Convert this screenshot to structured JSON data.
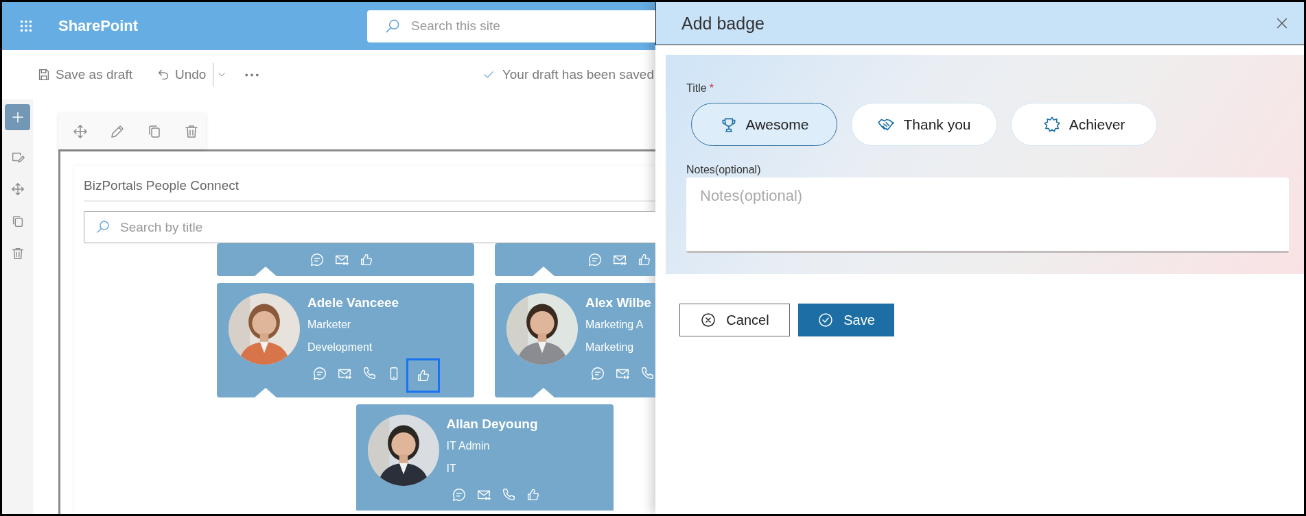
{
  "app_bar": {
    "brand": "SharePoint",
    "search": {
      "placeholder": "Search this site"
    }
  },
  "command_bar": {
    "save_draft": "Save as draft",
    "undo": "Undo",
    "status": "Your draft has been saved"
  },
  "web_part": {
    "title": "BizPortals People Connect",
    "search": {
      "placeholder": "Search by title"
    },
    "rows": [
      {
        "cards": [
          {
            "actions": [
              {
                "kind": "chat",
                "focused": false
              },
              {
                "kind": "mail",
                "focused": false
              },
              {
                "kind": "like",
                "focused": false
              }
            ]
          },
          {
            "actions": [
              {
                "kind": "chat",
                "focused": false
              },
              {
                "kind": "mail",
                "focused": false
              },
              {
                "kind": "like",
                "focused": false
              }
            ]
          }
        ]
      },
      {
        "cards": [
          {
            "name": "Adele Vanceee",
            "job_title": "Marketer",
            "department": "Development",
            "actions": [
              {
                "kind": "chat",
                "focused": false
              },
              {
                "kind": "mail",
                "focused": false
              },
              {
                "kind": "phone",
                "focused": false
              },
              {
                "kind": "mobile",
                "focused": false
              },
              {
                "kind": "like",
                "focused": true
              }
            ]
          },
          {
            "name": "Alex Wilbe",
            "job_title": "Marketing A",
            "department": "Marketing",
            "actions": [
              {
                "kind": "chat",
                "focused": false
              },
              {
                "kind": "mail",
                "focused": false
              },
              {
                "kind": "phone",
                "focused": false
              }
            ]
          }
        ]
      },
      {
        "cards": [
          {
            "name": "Allan Deyoung",
            "job_title": "IT Admin",
            "department": "IT",
            "actions": [
              {
                "kind": "chat",
                "focused": false
              },
              {
                "kind": "mail",
                "focused": false
              },
              {
                "kind": "phone",
                "focused": false
              },
              {
                "kind": "like",
                "focused": false
              }
            ]
          }
        ]
      }
    ]
  },
  "panel": {
    "title": "Add badge",
    "title_field": {
      "label": "Title",
      "required_mark": "*",
      "badges": [
        {
          "kind": "trophy",
          "label": "Awesome",
          "selected": true
        },
        {
          "kind": "handshake",
          "label": "Thank you",
          "selected": false
        },
        {
          "kind": "star",
          "label": "Achiever",
          "selected": false
        }
      ]
    },
    "notes": {
      "label": "Notes(optional)",
      "placeholder": "Notes(optional)"
    },
    "buttons": [
      {
        "kind": "cancel",
        "label": "Cancel"
      },
      {
        "kind": "save",
        "label": "Save"
      }
    ]
  }
}
